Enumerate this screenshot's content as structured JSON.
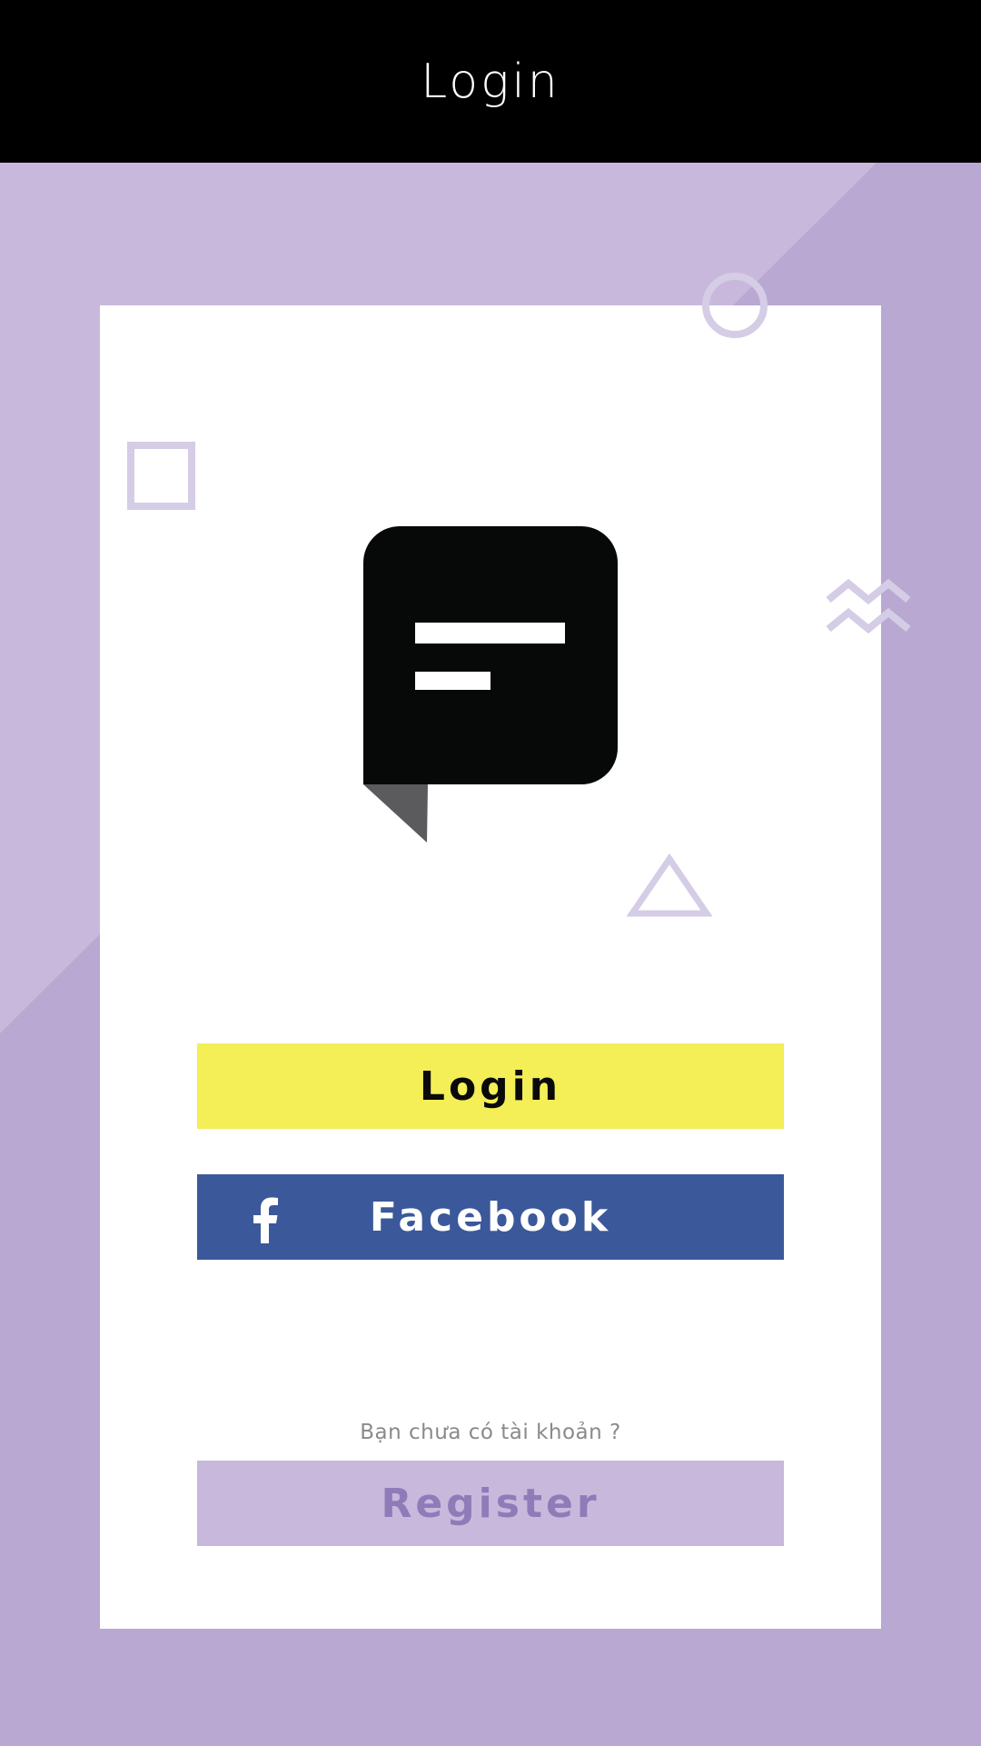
{
  "app_bar": {
    "title": "Login"
  },
  "buttons": {
    "login_label": "Login",
    "facebook_label": "Facebook",
    "register_label": "Register"
  },
  "register_prompt": "Bạn chưa có tài khoản ?",
  "icons": {
    "logo": "chat-bubble-icon",
    "facebook": "facebook-icon",
    "decor": [
      "circle-outline-icon",
      "square-outline-icon",
      "zigzag-icon",
      "triangle-outline-icon"
    ]
  },
  "colors": {
    "app_bar": "#000000",
    "background": "#b8a8d2",
    "background_light": "#c8b9dc",
    "card": "#ffffff",
    "login_button": "#f4ee57",
    "facebook_button": "#3b589a",
    "register_button": "#c8b8dc",
    "register_text": "#8e7bb8",
    "decor_stroke": "#d5cce6"
  }
}
